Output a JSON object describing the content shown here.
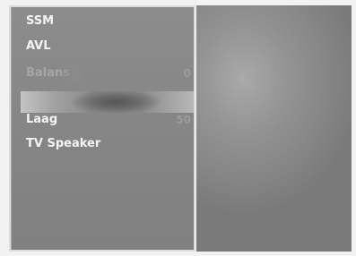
{
  "menu": {
    "items": [
      {
        "label": "SSM"
      },
      {
        "label": "AVL"
      },
      {
        "label": "Balans",
        "value": "0"
      },
      {
        "label": ""
      },
      {
        "label": "Laag",
        "value": "50"
      },
      {
        "label": "TV Speaker"
      }
    ]
  }
}
